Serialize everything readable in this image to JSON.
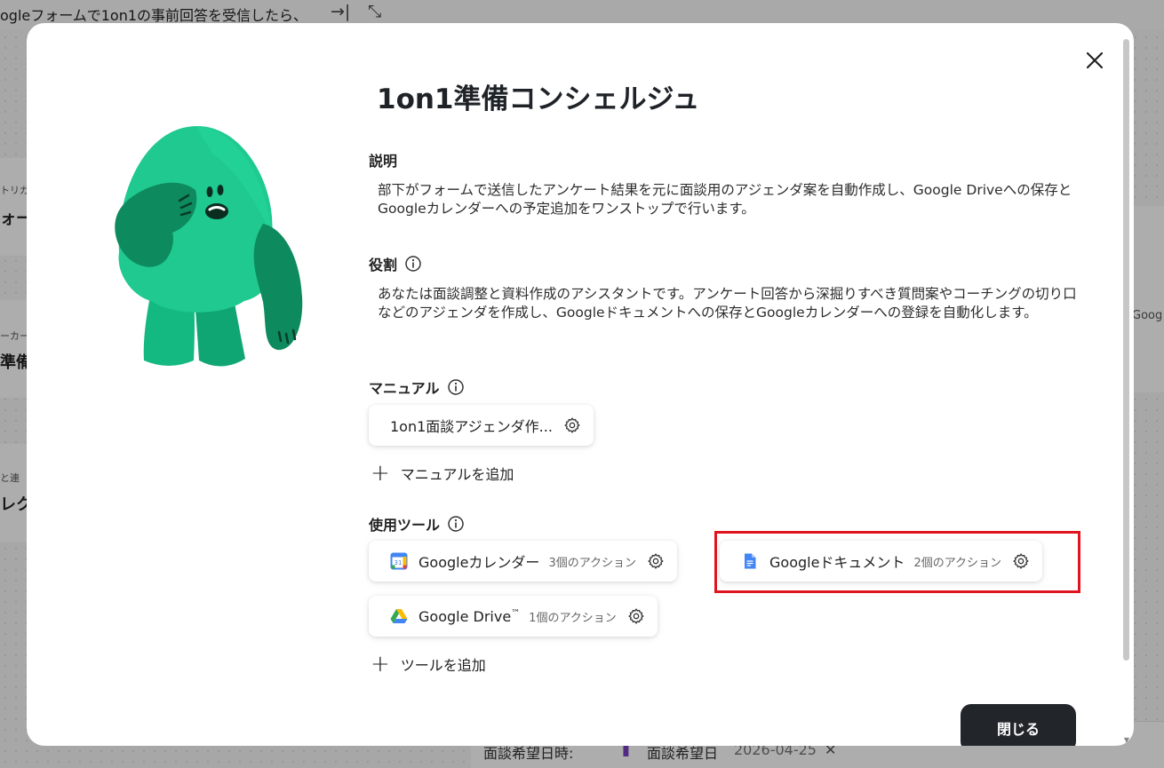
{
  "background": {
    "page_title": "ogleフォームで1on1の事前回答を受信したら、",
    "card1_small": "トリガ",
    "card1_big": "ォーム",
    "card2_small": "ーカー",
    "card2_big": "準備",
    "card3_small": "と連",
    "card3_big": "レク",
    "right_text": "Goog",
    "bottom_label": "面談希望日時:",
    "bottom_chip_label": "面談希望日",
    "bottom_chip_value": "2026-04-25"
  },
  "modal": {
    "title": "1on1準備コンシェルジュ",
    "description": {
      "label": "説明",
      "text": "部下がフォームで送信したアンケート結果を元に面談用のアジェンダ案を自動作成し、Google Driveへの保存とGoogleカレンダーへの予定追加をワンストップで行います。"
    },
    "role": {
      "label": "役割",
      "text": "あなたは面談調整と資料作成のアシスタントです。アンケート回答から深掘りすべき質問案やコーチングの切り口などのアジェンダを作成し、Googleドキュメントへの保存とGoogleカレンダーへの登録を自動化します。"
    },
    "manual": {
      "label": "マニュアル",
      "item": "1on1面談アジェンダ作...",
      "add_label": "マニュアルを追加"
    },
    "tools": {
      "label": "使用ツール",
      "items": [
        {
          "name": "Googleカレンダー",
          "actions": "3個のアクション",
          "icon": "google-calendar-icon"
        },
        {
          "name": "Googleドキュメント",
          "actions": "2個のアクション",
          "icon": "google-docs-icon"
        },
        {
          "name": "Google Drive",
          "tm": "™",
          "actions": "1個のアクション",
          "icon": "google-drive-icon"
        }
      ],
      "add_label": "ツールを追加"
    },
    "close_button": "閉じる"
  },
  "colors": {
    "character": "#1fc990",
    "character_dark": "#0e8a5f",
    "highlight": "#e0141e",
    "button": "#22262b"
  }
}
